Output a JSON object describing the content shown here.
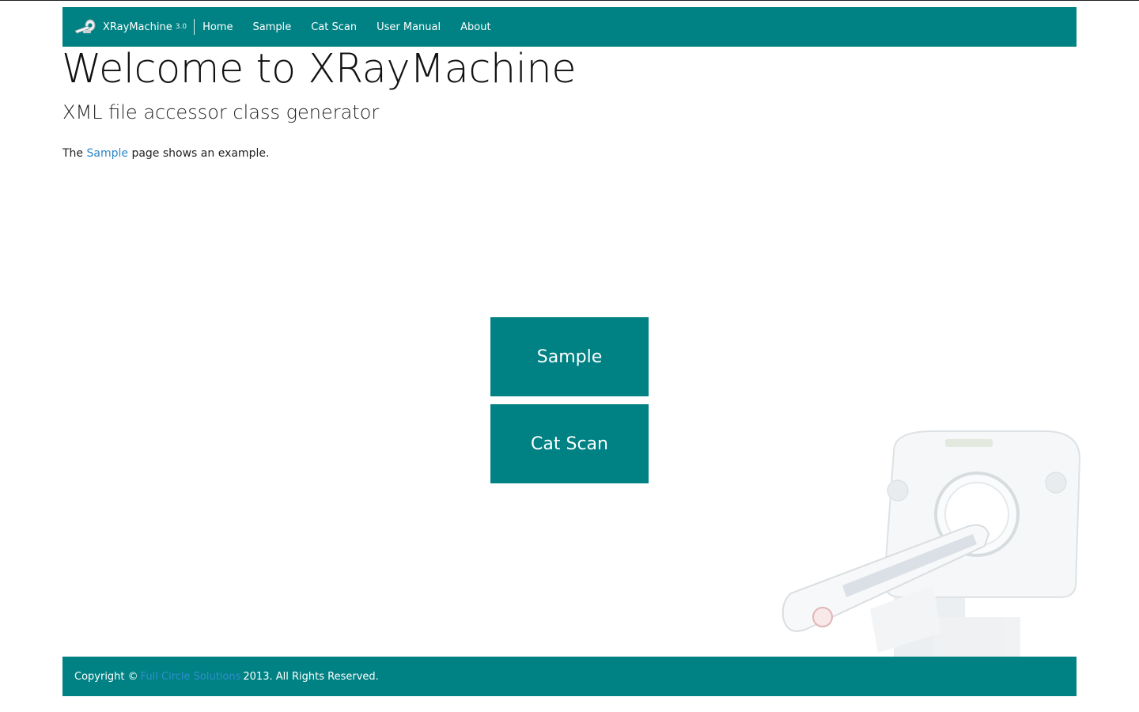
{
  "header": {
    "brand_name": "XRayMachine",
    "brand_version": "3.0",
    "brand_icon": "xray-machine-icon",
    "nav": [
      {
        "label": "Home"
      },
      {
        "label": "Sample"
      },
      {
        "label": "Cat Scan"
      },
      {
        "label": "User Manual"
      },
      {
        "label": "About"
      }
    ]
  },
  "main": {
    "title": "Welcome to XRayMachine",
    "subtitle": "XML file accessor class generator",
    "intro_before": "The",
    "intro_link": "Sample",
    "intro_after": "page shows an example.",
    "tiles": [
      {
        "label": "Sample"
      },
      {
        "label": "Cat Scan"
      }
    ],
    "background_image": "ct-scanner-image"
  },
  "footer": {
    "copyright_prefix": "Copyright ©",
    "company_link": "Full Circle Solutions",
    "copyright_suffix": "2013. All Rights Reserved."
  },
  "colors": {
    "accent": "#008183",
    "link": "#2e86c8",
    "text": "#222222",
    "background": "#ffffff"
  }
}
